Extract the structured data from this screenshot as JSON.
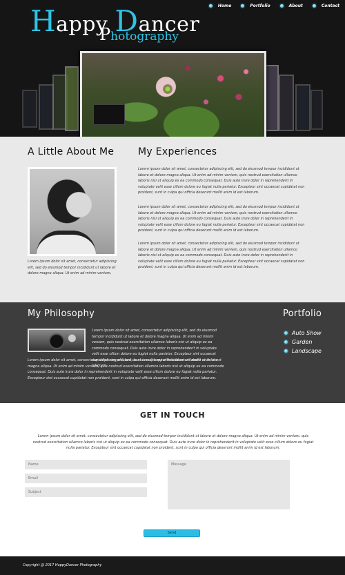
{
  "brand": {
    "line1_cap1": "H",
    "line1_rest1": "appy ",
    "line1_cap2": "D",
    "line1_rest2": "ancer",
    "line2_cap": "P",
    "line2_rest": "hotography",
    "accent_color": "#2ec4e6"
  },
  "nav": {
    "items": [
      {
        "label": "Home"
      },
      {
        "label": "Portfolio"
      },
      {
        "label": "About"
      },
      {
        "label": "Contact"
      }
    ]
  },
  "about": {
    "title": "A Little About Me",
    "text": "Lorem ipsum dolor sit amet, consectetur adipiscing elit, sed do eiusmod tempor incididunt ut labore et dolore magna aliqua. Ut enim ad minim veniam,"
  },
  "experiences": {
    "title": "My Experiences",
    "p1": "Lorem ipsum dolor sit amet, consectetur adipiscing elit, sed do eiusmod tempor incididunt ut labore et dolore magna aliqua. Ut enim ad minim veniam, quis nostrud exercitation ullamco laboris nisi ut aliquip ex ea commodo consequat. Duis aute irure dolor in reprehenderit in voluptate velit esse cillum dolore eu fugiat nulla pariatur. Excepteur sint occaecat cupidatat non proident, sunt in culpa qui officia deserunt mollit anim id est laborum.",
    "p2": "Lorem ipsum dolor sit amet, consectetur adipiscing elit, sed do eiusmod tempor incididunt ut labore et dolore magna aliqua. Ut enim ad minim veniam, quis nostrud exercitation ullamco laboris nisi ut aliquip ex ea commodo consequat. Duis aute irure dolor in reprehenderit in voluptate velit esse cillum dolore eu fugiat nulla pariatur. Excepteur sint occaecat cupidatat non proident, sunt in culpa qui officia deserunt mollit anim id est laborum.",
    "p3": "Lorem ipsum dolor sit amet, consectetur adipiscing elit, sed do eiusmod tempor incididunt ut labore et dolore magna aliqua. Ut enim ad minim veniam, quis nostrud exercitation ullamco laboris nisi ut aliquip ex ea commodo consequat. Duis aute irure dolor in reprehenderit in voluptate velit esse cillum dolore eu fugiat nulla pariatur. Excepteur sint occaecat cupidatat non proident, sunt in culpa qui officia deserunt mollit anim id est laborum."
  },
  "philosophy": {
    "title": "My Philosophy",
    "text_a": "Lorem ipsum dolor sit amet, consectetur adipiscing elit, sed do eiusmod tempor incididunt ut labore et dolore magna aliqua. Ut enim ad minim veniam, quis nostrud exercitation ullamco laboris nisi ut aliquip ex ea commodo consequat. Duis aute irure dolor in reprehenderit in voluptate velit esse cillum dolore eu fugiat nulla pariatur. Excepteur sint occaecat cupidatat non proident, sunt in culpa qui officia deserunt mollit anim id est laborum.",
    "text_b": "Lorem ipsum dolor sit amet, consectetur adipiscing elit, sed do eiusmod tempor incididunt ut labore et dolore magna aliqua. Ut enim ad minim veniam, quis nostrud exercitation ullamco laboris nisi ut aliquip ex ea commodo consequat. Duis aute irure dolor in reprehenderit in voluptate velit esse cillum dolore eu fugiat nulla pariatur. Excepteur sint occaecat cupidatat non proident, sunt in culpa qui officia deserunt mollit anim id est laborum."
  },
  "portfolio": {
    "title": "Portfolio",
    "items": [
      {
        "label": "Auto Show"
      },
      {
        "label": "Garden"
      },
      {
        "label": "Landscape"
      }
    ]
  },
  "contact": {
    "title": "GET IN TOUCH",
    "text": "Lorem ipsum dolor sit amet, consectetur adipiscing elit, sed do eiusmod tempor incididunt ut labore et dolore magna aliqua. Ut enim ad minim veniam, quis nostrud exercitation ullamco laboris nisi ut aliquip ex ea commodo consequat. Duis aute irure dolor in reprehenderit in voluptate velit esse cillum dolore eu fugiat nulla pariatur. Excepteur sint occaecat cupidatat non proident, sunt in culpa qui officia deserunt mollit anim id est laborum.",
    "name_placeholder": "Name",
    "email_placeholder": "Email",
    "subject_placeholder": "Subject",
    "message_placeholder": "Message",
    "send_label": "Send",
    "button_color": "#2bbde6"
  },
  "footer": {
    "copyright": "Copyright @ 2017 HappyDancer Photography"
  }
}
